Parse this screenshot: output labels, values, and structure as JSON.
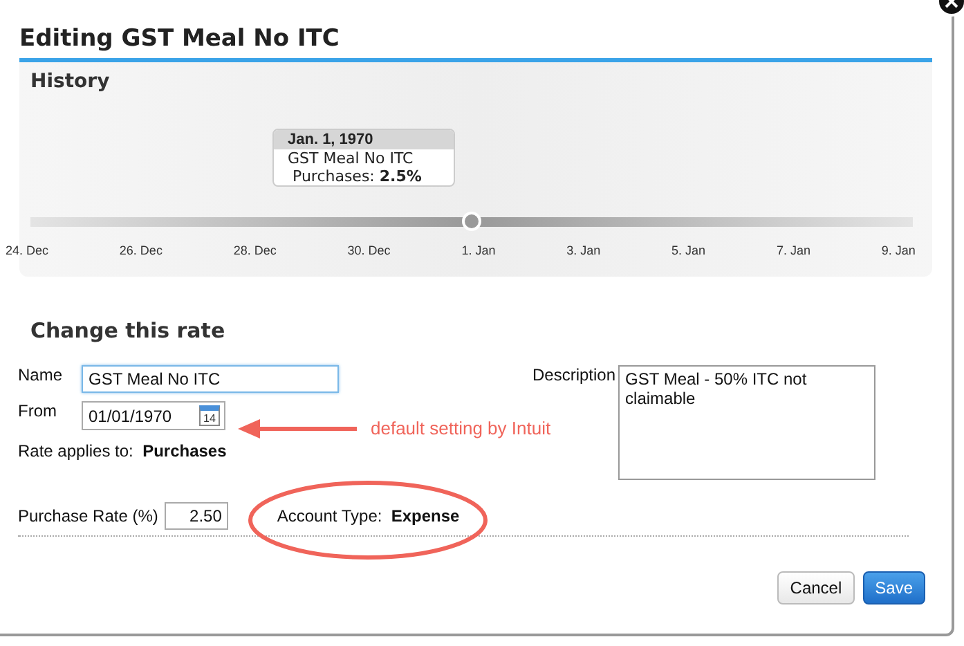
{
  "dialog": {
    "title": "Editing GST Meal No ITC"
  },
  "history": {
    "heading": "History",
    "tooltip": {
      "date": "Jan. 1, 1970",
      "name": "GST Meal No ITC",
      "rate_label": "Purchases:",
      "rate_value": "2.5%"
    },
    "level": 0.5,
    "ticks": [
      "24. Dec",
      "26. Dec",
      "28. Dec",
      "30. Dec",
      "1. Jan",
      "3. Jan",
      "5. Jan",
      "7. Jan",
      "9. Jan"
    ]
  },
  "form": {
    "heading": "Change this rate",
    "name_label": "Name",
    "name_value": "GST Meal No ITC",
    "from_label": "From",
    "from_value": "01/01/1970",
    "calendar_day": "14",
    "applies_label": "Rate applies to:",
    "applies_value": "Purchases",
    "rate_label": "Purchase Rate (%)",
    "rate_value": "2.50",
    "account_label": "Account Type:",
    "account_value": "Expense",
    "description_label": "Description",
    "description_value": "GST Meal - 50% ITC not claimable"
  },
  "annotation": {
    "text": "default setting by Intuit"
  },
  "buttons": [
    {
      "label": "Cancel",
      "kind": "secondary"
    },
    {
      "label": "Save",
      "kind": "primary"
    }
  ]
}
